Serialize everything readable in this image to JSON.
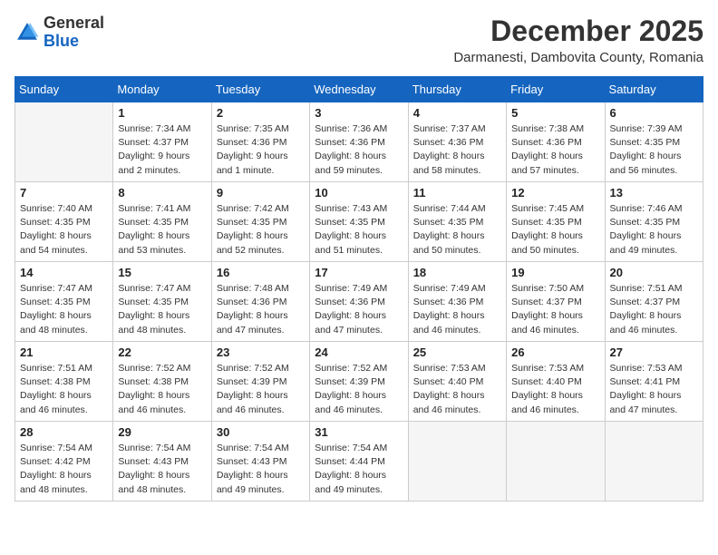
{
  "header": {
    "logo_general": "General",
    "logo_blue": "Blue",
    "month_title": "December 2025",
    "location": "Darmanesti, Dambovita County, Romania"
  },
  "days_of_week": [
    "Sunday",
    "Monday",
    "Tuesday",
    "Wednesday",
    "Thursday",
    "Friday",
    "Saturday"
  ],
  "weeks": [
    [
      {
        "day": "",
        "info": ""
      },
      {
        "day": "1",
        "info": "Sunrise: 7:34 AM\nSunset: 4:37 PM\nDaylight: 9 hours\nand 2 minutes."
      },
      {
        "day": "2",
        "info": "Sunrise: 7:35 AM\nSunset: 4:36 PM\nDaylight: 9 hours\nand 1 minute."
      },
      {
        "day": "3",
        "info": "Sunrise: 7:36 AM\nSunset: 4:36 PM\nDaylight: 8 hours\nand 59 minutes."
      },
      {
        "day": "4",
        "info": "Sunrise: 7:37 AM\nSunset: 4:36 PM\nDaylight: 8 hours\nand 58 minutes."
      },
      {
        "day": "5",
        "info": "Sunrise: 7:38 AM\nSunset: 4:36 PM\nDaylight: 8 hours\nand 57 minutes."
      },
      {
        "day": "6",
        "info": "Sunrise: 7:39 AM\nSunset: 4:35 PM\nDaylight: 8 hours\nand 56 minutes."
      }
    ],
    [
      {
        "day": "7",
        "info": "Sunrise: 7:40 AM\nSunset: 4:35 PM\nDaylight: 8 hours\nand 54 minutes."
      },
      {
        "day": "8",
        "info": "Sunrise: 7:41 AM\nSunset: 4:35 PM\nDaylight: 8 hours\nand 53 minutes."
      },
      {
        "day": "9",
        "info": "Sunrise: 7:42 AM\nSunset: 4:35 PM\nDaylight: 8 hours\nand 52 minutes."
      },
      {
        "day": "10",
        "info": "Sunrise: 7:43 AM\nSunset: 4:35 PM\nDaylight: 8 hours\nand 51 minutes."
      },
      {
        "day": "11",
        "info": "Sunrise: 7:44 AM\nSunset: 4:35 PM\nDaylight: 8 hours\nand 50 minutes."
      },
      {
        "day": "12",
        "info": "Sunrise: 7:45 AM\nSunset: 4:35 PM\nDaylight: 8 hours\nand 50 minutes."
      },
      {
        "day": "13",
        "info": "Sunrise: 7:46 AM\nSunset: 4:35 PM\nDaylight: 8 hours\nand 49 minutes."
      }
    ],
    [
      {
        "day": "14",
        "info": "Sunrise: 7:47 AM\nSunset: 4:35 PM\nDaylight: 8 hours\nand 48 minutes."
      },
      {
        "day": "15",
        "info": "Sunrise: 7:47 AM\nSunset: 4:35 PM\nDaylight: 8 hours\nand 48 minutes."
      },
      {
        "day": "16",
        "info": "Sunrise: 7:48 AM\nSunset: 4:36 PM\nDaylight: 8 hours\nand 47 minutes."
      },
      {
        "day": "17",
        "info": "Sunrise: 7:49 AM\nSunset: 4:36 PM\nDaylight: 8 hours\nand 47 minutes."
      },
      {
        "day": "18",
        "info": "Sunrise: 7:49 AM\nSunset: 4:36 PM\nDaylight: 8 hours\nand 46 minutes."
      },
      {
        "day": "19",
        "info": "Sunrise: 7:50 AM\nSunset: 4:37 PM\nDaylight: 8 hours\nand 46 minutes."
      },
      {
        "day": "20",
        "info": "Sunrise: 7:51 AM\nSunset: 4:37 PM\nDaylight: 8 hours\nand 46 minutes."
      }
    ],
    [
      {
        "day": "21",
        "info": "Sunrise: 7:51 AM\nSunset: 4:38 PM\nDaylight: 8 hours\nand 46 minutes."
      },
      {
        "day": "22",
        "info": "Sunrise: 7:52 AM\nSunset: 4:38 PM\nDaylight: 8 hours\nand 46 minutes."
      },
      {
        "day": "23",
        "info": "Sunrise: 7:52 AM\nSunset: 4:39 PM\nDaylight: 8 hours\nand 46 minutes."
      },
      {
        "day": "24",
        "info": "Sunrise: 7:52 AM\nSunset: 4:39 PM\nDaylight: 8 hours\nand 46 minutes."
      },
      {
        "day": "25",
        "info": "Sunrise: 7:53 AM\nSunset: 4:40 PM\nDaylight: 8 hours\nand 46 minutes."
      },
      {
        "day": "26",
        "info": "Sunrise: 7:53 AM\nSunset: 4:40 PM\nDaylight: 8 hours\nand 46 minutes."
      },
      {
        "day": "27",
        "info": "Sunrise: 7:53 AM\nSunset: 4:41 PM\nDaylight: 8 hours\nand 47 minutes."
      }
    ],
    [
      {
        "day": "28",
        "info": "Sunrise: 7:54 AM\nSunset: 4:42 PM\nDaylight: 8 hours\nand 48 minutes."
      },
      {
        "day": "29",
        "info": "Sunrise: 7:54 AM\nSunset: 4:43 PM\nDaylight: 8 hours\nand 48 minutes."
      },
      {
        "day": "30",
        "info": "Sunrise: 7:54 AM\nSunset: 4:43 PM\nDaylight: 8 hours\nand 49 minutes."
      },
      {
        "day": "31",
        "info": "Sunrise: 7:54 AM\nSunset: 4:44 PM\nDaylight: 8 hours\nand 49 minutes."
      },
      {
        "day": "",
        "info": ""
      },
      {
        "day": "",
        "info": ""
      },
      {
        "day": "",
        "info": ""
      }
    ]
  ]
}
